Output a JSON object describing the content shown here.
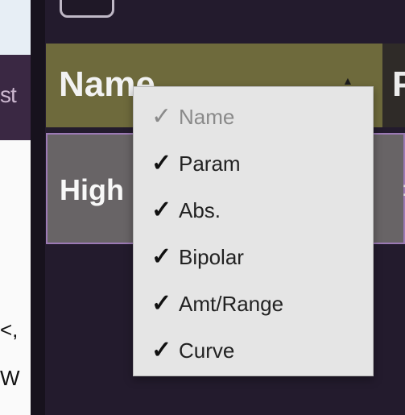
{
  "left_strip": {
    "band_text": "st",
    "lower_text_1": "<,",
    "lower_text_2": "W"
  },
  "table": {
    "header_name": "Name",
    "header_next": "P",
    "row_name": "High",
    "row_right_mark": ":"
  },
  "context_menu": {
    "items": [
      {
        "label": "Name",
        "checked": true,
        "enabled": false
      },
      {
        "label": "Param",
        "checked": true,
        "enabled": true
      },
      {
        "label": "Abs.",
        "checked": true,
        "enabled": true
      },
      {
        "label": "Bipolar",
        "checked": true,
        "enabled": true
      },
      {
        "label": "Amt/Range",
        "checked": true,
        "enabled": true
      },
      {
        "label": "Curve",
        "checked": true,
        "enabled": true
      }
    ]
  },
  "colors": {
    "panel_bg": "#231b2d",
    "header_bg": "#6e6a3c",
    "row_bg": "#686466",
    "row_border": "#9b79b4",
    "menu_bg": "#e5e5e5"
  }
}
